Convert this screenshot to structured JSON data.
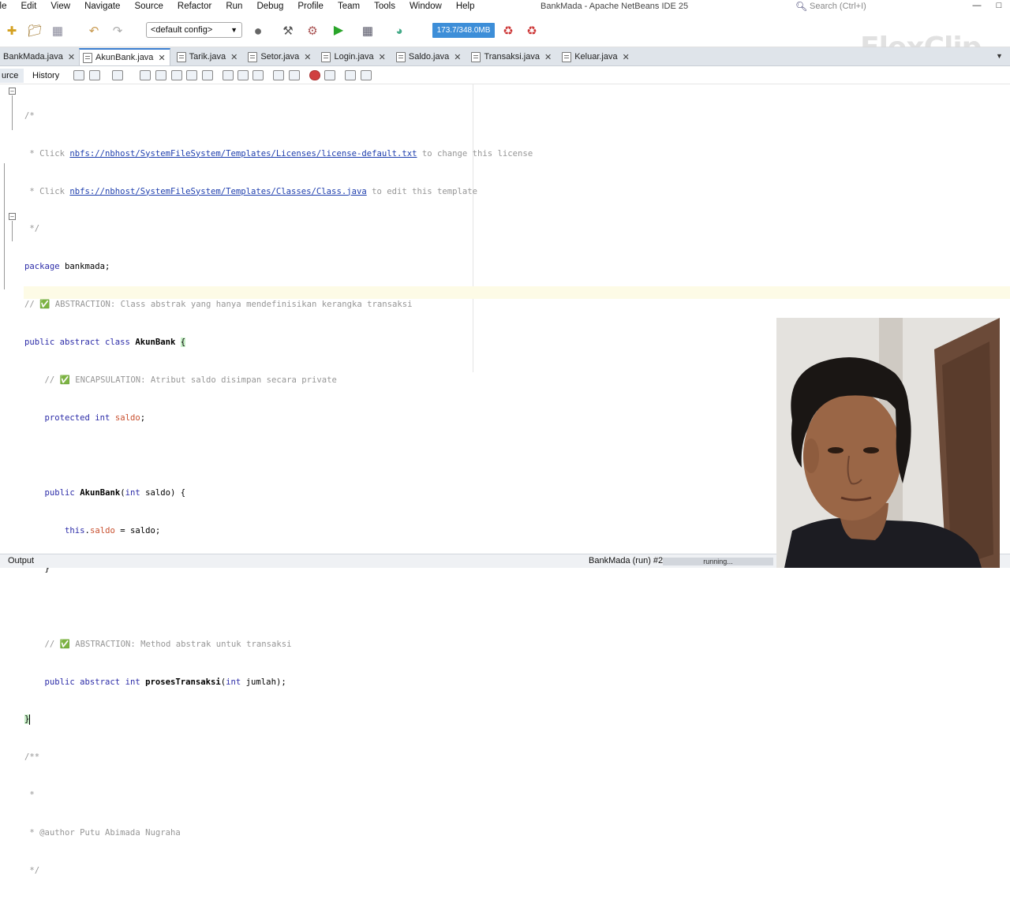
{
  "window": {
    "title": "BankMada - Apache NetBeans IDE 25",
    "search_placeholder": "Search (Ctrl+I)"
  },
  "menu": [
    "ile",
    "Edit",
    "View",
    "Navigate",
    "Source",
    "Refactor",
    "Run",
    "Debug",
    "Profile",
    "Team",
    "Tools",
    "Window",
    "Help"
  ],
  "toolbar": {
    "config": "<default config>",
    "memory": "173.7/348.0MB",
    "watermark": "FlexClip"
  },
  "tabs": [
    {
      "label": "BankMada.java",
      "active": false
    },
    {
      "label": "AkunBank.java",
      "active": true
    },
    {
      "label": "Tarik.java",
      "active": false
    },
    {
      "label": "Setor.java",
      "active": false
    },
    {
      "label": "Login.java",
      "active": false
    },
    {
      "label": "Saldo.java",
      "active": false
    },
    {
      "label": "Transaksi.java",
      "active": false
    },
    {
      "label": "Keluar.java",
      "active": false
    }
  ],
  "editor_toolbar": {
    "source": "urce",
    "history": "History"
  },
  "code": {
    "l1": "/*",
    "l2a": " * Click ",
    "l2link": "nbfs://nbhost/SystemFileSystem/Templates/Licenses/license-default.txt",
    "l2b": " to change this license",
    "l3a": " * Click ",
    "l3link": "nbfs://nbhost/SystemFileSystem/Templates/Classes/Class.java",
    "l3b": " to edit this template",
    "l4": " */",
    "l5kw": "package",
    "l5": " bankmada;",
    "l6": "// ✅ ABSTRACTION: Class abstrak yang hanya mendefinisikan kerangka transaksi",
    "l7kw": "public abstract class",
    "l7name": "AkunBank",
    "l7brace": "{",
    "l8": "    // ✅ ENCAPSULATION: Atribut saldo disimpan secara private",
    "l9kw": "protected int",
    "l9fld": "saldo",
    "l9end": ";",
    "l11kw": "public",
    "l11name": "AkunBank",
    "l11a": "(",
    "l11kw2": "int",
    "l11b": " saldo) {",
    "l12kw": "this",
    "l12dot": ".",
    "l12fld": "saldo",
    "l12end": " = saldo;",
    "l13": "    }",
    "l15": "    // ✅ ABSTRACTION: Method abstrak untuk transaksi",
    "l16kw": "public abstract int",
    "l16name": "prosesTransaksi",
    "l16a": "(",
    "l16kw2": "int",
    "l16b": " jumlah);",
    "l17": "}",
    "l18": "/**",
    "l19": " *",
    "l20": " * @author Putu Abimada Nugraha",
    "l21": " */"
  },
  "status": {
    "output": "Output",
    "process": "BankMada (run) #2",
    "progress": "running..."
  }
}
